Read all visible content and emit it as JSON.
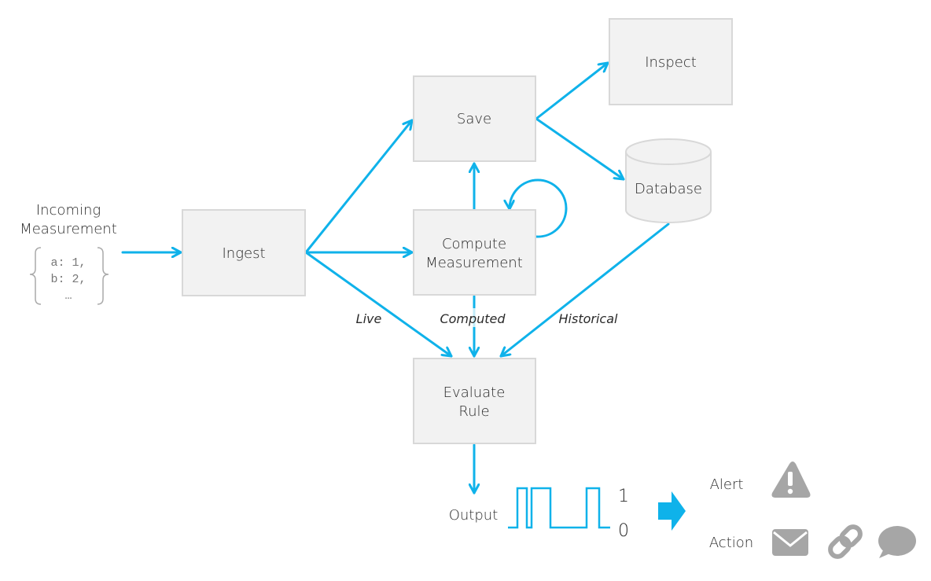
{
  "diagram": {
    "accent_color": "#0fb2ea",
    "node_fill": "#f2f2f2",
    "icon_color": "#a6a6a6",
    "input": {
      "title_line1": "Incoming",
      "title_line2": "Measurement",
      "payload_lines": [
        "a: 1,",
        "b: 2,",
        "…"
      ]
    },
    "nodes": {
      "ingest": "Ingest",
      "save": "Save",
      "inspect": "Inspect",
      "database": "Database",
      "compute_line1": "Compute",
      "compute_line2": "Measurement",
      "evaluate_line1": "Evaluate",
      "evaluate_line2": "Rule"
    },
    "edge_labels": {
      "live": "Live",
      "computed": "Computed",
      "historical": "Historical"
    },
    "output": {
      "label": "Output",
      "signal_high": "1",
      "signal_low": "0",
      "signal_sequence": [
        0,
        1,
        0,
        1,
        0,
        1,
        0
      ]
    },
    "results": {
      "alert_label": "Alert",
      "action_label": "Action",
      "alert_icons": [
        "warning-icon"
      ],
      "action_icons": [
        "email-icon",
        "link-icon",
        "chat-icon"
      ]
    }
  }
}
